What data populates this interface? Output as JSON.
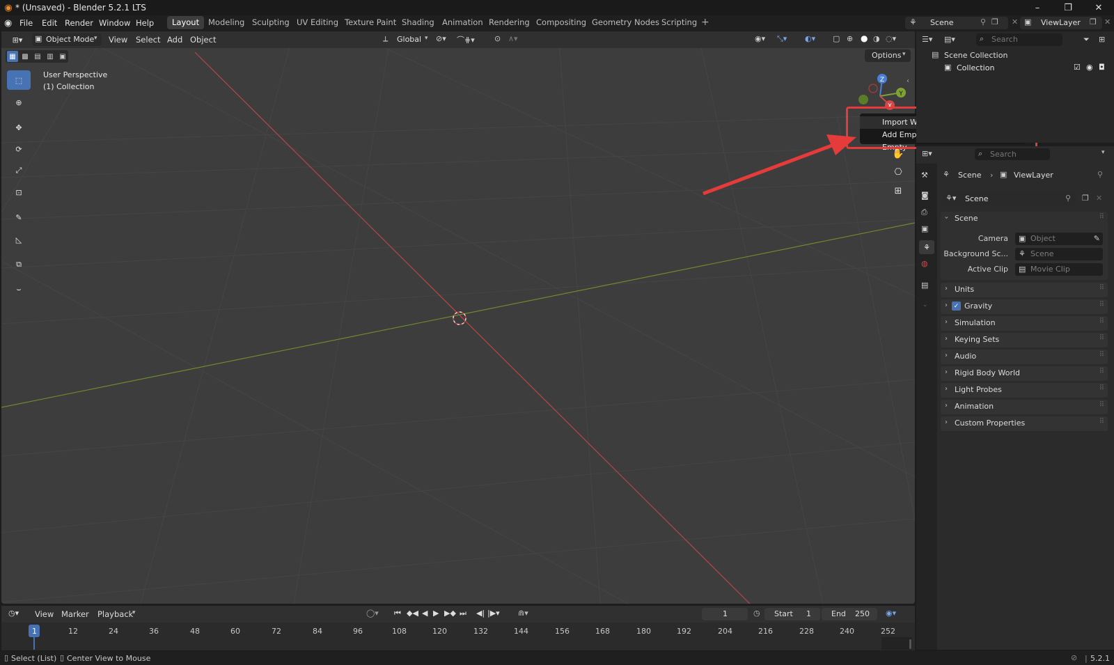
{
  "window": {
    "title": "* (Unsaved) - Blender 5.2.1 LTS"
  },
  "menus": [
    "File",
    "Edit",
    "Render",
    "Window",
    "Help"
  ],
  "workspaces": [
    "Layout",
    "Modeling",
    "Sculpting",
    "UV Editing",
    "Texture Paint",
    "Shading",
    "Animation",
    "Rendering",
    "Compositing",
    "Geometry Nodes",
    "Scripting"
  ],
  "active_workspace": "Layout",
  "scene_selector": {
    "scene": "Scene",
    "view_layer": "ViewLayer"
  },
  "viewport_header": {
    "mode": "Object Mode",
    "menus": [
      "View",
      "Select",
      "Add",
      "Object"
    ],
    "transform_orientation": "Global",
    "options_label": "Options"
  },
  "viewport": {
    "perspective_label": "User Perspective",
    "collection_label": "(1) Collection",
    "gizmo_axes": [
      "Z",
      "Y",
      "X"
    ]
  },
  "context_menu": {
    "items": [
      "Import Wavefront OBJ",
      "Add Empty Image/Drop Image to Empty"
    ],
    "highlighted_index": 0
  },
  "outliner": {
    "search_placeholder": "Search",
    "scene_collection": "Scene Collection",
    "collection": "Collection"
  },
  "properties": {
    "search_placeholder": "Search",
    "breadcrumb": [
      "Scene",
      "ViewLayer"
    ],
    "datablock": "Scene",
    "scene_section": "Scene",
    "fields": [
      {
        "label": "Camera",
        "placeholder": "Object"
      },
      {
        "label": "Background Sc...",
        "placeholder": "Scene"
      },
      {
        "label": "Active Clip",
        "placeholder": "Movie Clip"
      }
    ],
    "sections": [
      "Units",
      "Gravity",
      "Simulation",
      "Keying Sets",
      "Audio",
      "Rigid Body World",
      "Light Probes",
      "Animation",
      "Custom Properties"
    ],
    "gravity_checked": true
  },
  "timeline": {
    "menus": [
      "View",
      "Marker",
      "Playback"
    ],
    "current_frame": "1",
    "start_label": "Start",
    "start_value": "1",
    "end_label": "End",
    "end_value": "250",
    "ruler": [
      "1",
      "12",
      "24",
      "36",
      "48",
      "60",
      "72",
      "84",
      "96",
      "108",
      "120",
      "132",
      "144",
      "156",
      "168",
      "180",
      "192",
      "204",
      "216",
      "228",
      "240",
      "252"
    ]
  },
  "statusbar": {
    "left_hints": [
      "Select (List)",
      "Center View to Mouse"
    ],
    "version": "5.2.1"
  },
  "colors": {
    "accent": "#4772b3",
    "highlight_box": "#e53b3b",
    "x_axis": "#c43c3c",
    "y_axis": "#7a9a2a"
  }
}
